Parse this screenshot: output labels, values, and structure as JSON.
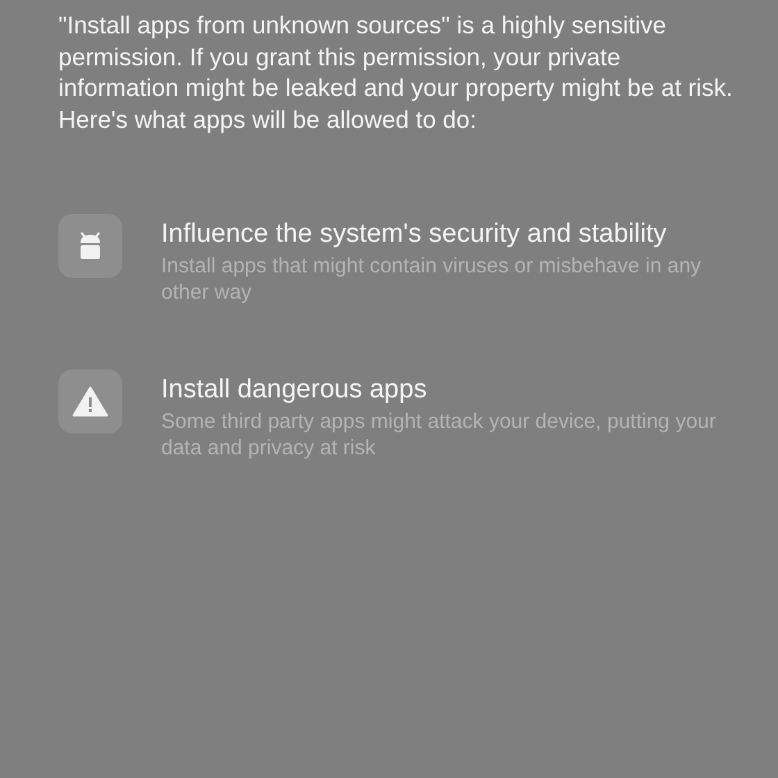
{
  "intro": "\"Install apps from unknown sources\" is a highly sensitive permission. If you grant this permission, your private information might be leaked and your property might be at risk. Here's what apps will be allowed to do:",
  "items": [
    {
      "title": "Influence the system's security and stability",
      "description": "Install apps that might contain viruses or misbehave in any other way"
    },
    {
      "title": "Install dangerous apps",
      "description": "Some third party apps might attack your device, putting your data and privacy at risk"
    }
  ]
}
